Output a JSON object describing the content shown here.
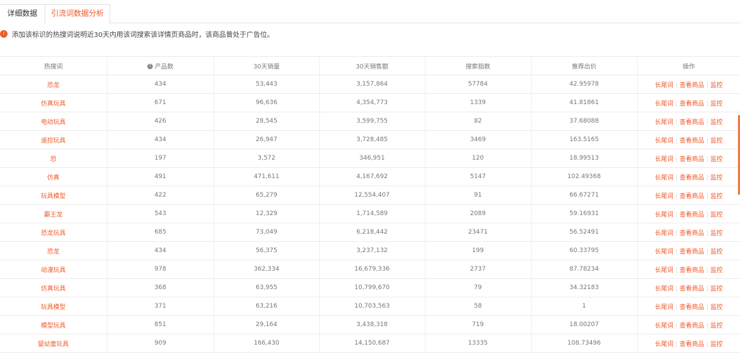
{
  "tabs": [
    {
      "label": "详细数据"
    },
    {
      "label": "引流词数据分析"
    }
  ],
  "notice": {
    "badge": "i",
    "text": "添加该标识的热搜词说明近30天内用该词搜索该详情页商品时，该商品曾处于广告位。"
  },
  "table": {
    "headers": [
      "热搜词",
      "产品数",
      "30天销量",
      "30天销售额",
      "搜索指数",
      "推荐出价",
      "操作"
    ],
    "help_icon": "?",
    "actions": [
      "长尾词",
      "查看商品",
      "监控"
    ],
    "rows": [
      [
        "恐龙",
        "434",
        "53,443",
        "3,157,864",
        "57784",
        "42.95978"
      ],
      [
        "仿真玩具",
        "671",
        "96,636",
        "4,354,773",
        "1339",
        "41.81861"
      ],
      [
        "电动玩具",
        "426",
        "28,545",
        "3,599,755",
        "82",
        "37.68088"
      ],
      [
        "遥控玩具",
        "434",
        "26,947",
        "3,728,485",
        "3469",
        "163.5165"
      ],
      [
        "恐",
        "197",
        "3,572",
        "346,951",
        "120",
        "18.99513"
      ],
      [
        "仿真",
        "491",
        "471,611",
        "4,167,692",
        "5147",
        "102.49368"
      ],
      [
        "玩具模型",
        "422",
        "65,279",
        "12,554,407",
        "91",
        "66.67271"
      ],
      [
        "霸王龙",
        "543",
        "12,329",
        "1,714,589",
        "2089",
        "59.16931"
      ],
      [
        "恐龙玩具",
        "685",
        "73,049",
        "6,218,442",
        "23471",
        "56.52491"
      ],
      [
        "恐龙",
        "434",
        "56,375",
        "3,237,132",
        "199",
        "60.33795"
      ],
      [
        "动漫玩具",
        "978",
        "362,334",
        "16,679,336",
        "2737",
        "87.78234"
      ],
      [
        "仿真玩具",
        "368",
        "63,955",
        "10,799,670",
        "79",
        "34.32183"
      ],
      [
        "玩具模型",
        "371",
        "63,216",
        "10,703,563",
        "58",
        "1"
      ],
      [
        "模型玩具",
        "851",
        "29,164",
        "3,438,318",
        "719",
        "18.00207"
      ],
      [
        "婴幼童玩具",
        "909",
        "166,430",
        "14,150,687",
        "13335",
        "108.73496"
      ]
    ]
  }
}
